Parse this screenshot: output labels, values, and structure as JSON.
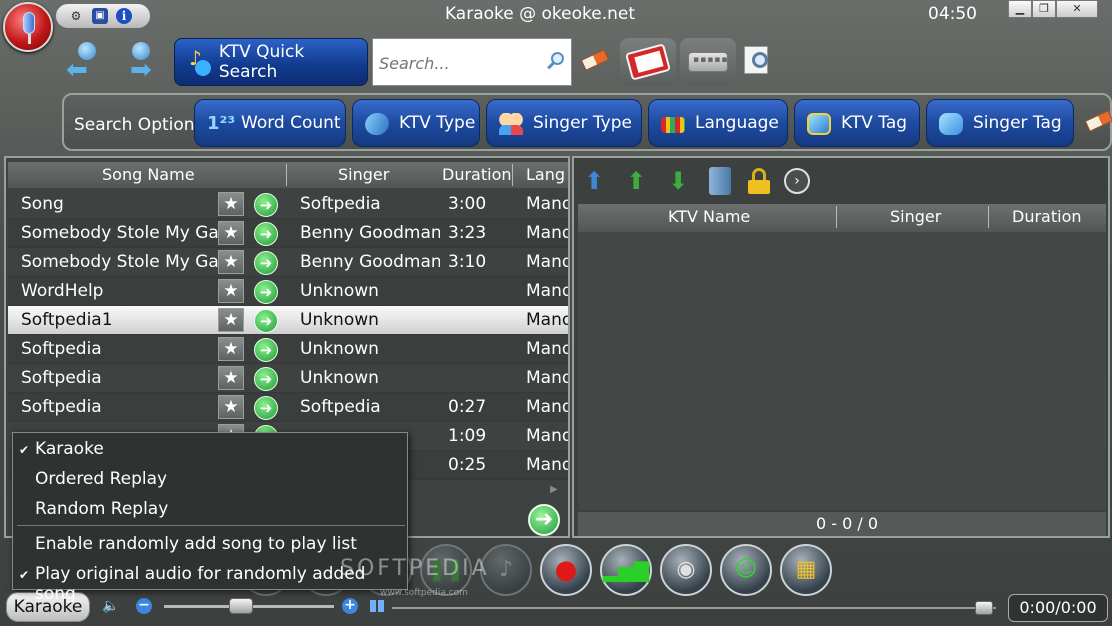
{
  "window": {
    "title": "Karaoke @ okeoke.net",
    "clock": "04:50",
    "minimize": "▁",
    "restore": "❐",
    "close": "✕"
  },
  "toolbar": {
    "quick_search_label": "KTV Quick Search",
    "search_placeholder": "Search..."
  },
  "search_option": {
    "label": "Search Option",
    "buttons": [
      {
        "label": "Word Count",
        "icon": "word-count-icon"
      },
      {
        "label": "KTV Type",
        "icon": "ktv-type-icon"
      },
      {
        "label": "Singer Type",
        "icon": "singer-type-icon"
      },
      {
        "label": "Language",
        "icon": "language-icon"
      },
      {
        "label": "KTV Tag",
        "icon": "ktv-tag-icon"
      },
      {
        "label": "Singer Tag",
        "icon": "singer-tag-icon"
      }
    ]
  },
  "song_table": {
    "columns": [
      "Song Name",
      "Singer",
      "Duration",
      "Lang"
    ],
    "rows": [
      {
        "name": "Song",
        "singer": "Softpedia",
        "duration": "3:00",
        "lang": "Mand"
      },
      {
        "name": "Somebody Stole My Gal",
        "singer": "Benny Goodman",
        "duration": "3:23",
        "lang": "Mand"
      },
      {
        "name": "Somebody Stole My Gal",
        "singer": "Benny Goodman",
        "duration": "3:10",
        "lang": "Mand"
      },
      {
        "name": "WordHelp",
        "singer": "Unknown",
        "duration": "",
        "lang": "Mand"
      },
      {
        "name": "Softpedia1",
        "singer": "Unknown",
        "duration": "",
        "lang": "Mand"
      },
      {
        "name": "Softpedia",
        "singer": "Unknown",
        "duration": "",
        "lang": "Mand"
      },
      {
        "name": "Softpedia",
        "singer": "Unknown",
        "duration": "",
        "lang": "Mand"
      },
      {
        "name": "Softpedia",
        "singer": "Softpedia",
        "duration": "0:27",
        "lang": "Mand"
      },
      {
        "name": "",
        "singer": "",
        "duration": "1:09",
        "lang": "Mand"
      },
      {
        "name": "",
        "singer": "",
        "duration": "0:25",
        "lang": "Mand"
      }
    ],
    "selected_index": 4,
    "star_glyph": "★",
    "go_glyph": "➜"
  },
  "playlist": {
    "columns": [
      "KTV Name",
      "Singer",
      "Duration"
    ],
    "footer": "0  - 0  / 0"
  },
  "menu": {
    "items": [
      {
        "label": "Karaoke",
        "checked": true
      },
      {
        "label": "Ordered Replay",
        "checked": false
      },
      {
        "label": "Random Replay",
        "checked": false
      },
      {
        "label": "Enable randomly add song to play list",
        "checked": false
      },
      {
        "label": "Play original audio for randomly added song",
        "checked": true
      }
    ],
    "check_glyph": "✔"
  },
  "status": {
    "mode": "Karaoke",
    "time": "0:00/0:00",
    "volume_fraction": 0.45,
    "seek_fraction": 0.98
  },
  "watermark": {
    "text": "SOFTPEDIA",
    "url": "www.softpedia.com"
  }
}
